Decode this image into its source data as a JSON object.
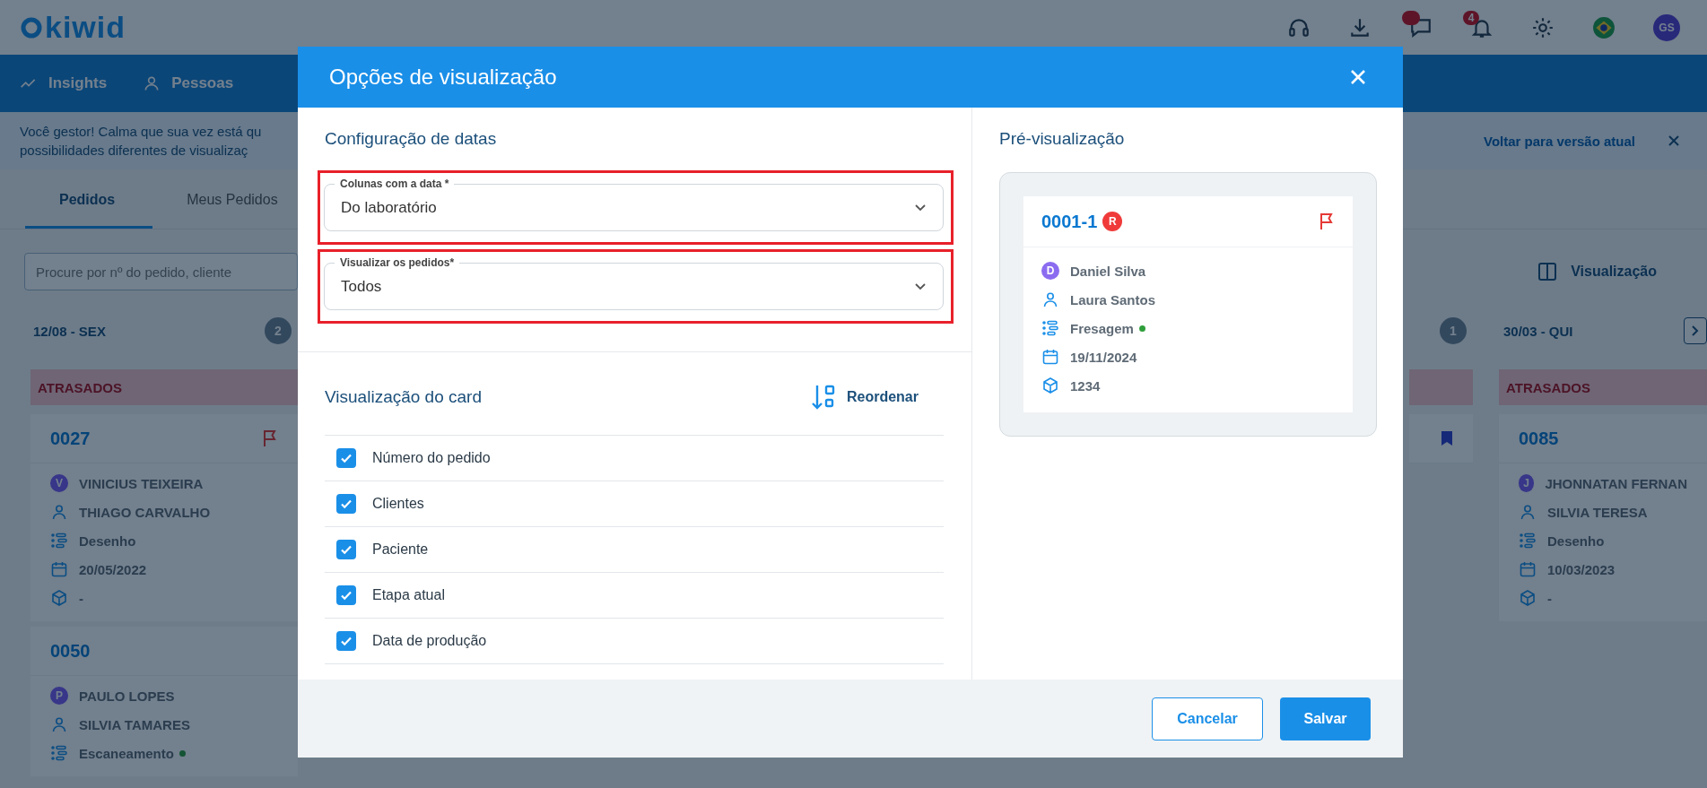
{
  "app_bar": {
    "logo": "kiwid",
    "actions": [
      {
        "kind": "headset"
      },
      {
        "kind": "download"
      },
      {
        "kind": "chat",
        "badge": true
      },
      {
        "kind": "bell",
        "badge": true,
        "count": "4"
      },
      {
        "kind": "settings"
      },
      {
        "kind": "flag"
      }
    ],
    "avatar": "GS"
  },
  "nav": [
    {
      "kind": "insights",
      "label": "Insights"
    },
    {
      "kind": "people",
      "label": "Pessoas"
    }
  ],
  "banner": {
    "lines": [
      "Você gestor! Calma que sua vez está qu",
      "possibilidades diferentes de visualizaç"
    ],
    "link": "Voltar para versão atual"
  },
  "tabs": [
    {
      "label": "Pedidos",
      "selected": true
    },
    {
      "label": "Meus Pedidos",
      "selected": false
    }
  ],
  "search": {
    "placeholder": "Procure por nº do pedido, cliente"
  },
  "view_button": "Visualização",
  "board": {
    "columns": [
      {
        "date": "12/08 - SEX",
        "count": "2",
        "group": "ATRASADOS",
        "cards": [
          {
            "number": "0027",
            "marker": {
              "kind": "flag"
            },
            "fields": [
              {
                "kind": "avatar",
                "initial": "V",
                "text": "VINICIUS TEIXEIRA"
              },
              {
                "kind": "person",
                "text": "THIAGO CARVALHO"
              },
              {
                "kind": "stage",
                "text": "Desenho"
              },
              {
                "kind": "date",
                "text": "20/05/2022"
              },
              {
                "kind": "box",
                "text": "-"
              }
            ]
          },
          {
            "number": "0050",
            "fields": [
              {
                "kind": "avatar",
                "initial": "P",
                "text": "PAULO LOPES"
              },
              {
                "kind": "person",
                "text": "SILVIA TAMARES"
              },
              {
                "kind": "stage",
                "text": "Escaneamento",
                "dot": true
              }
            ]
          }
        ]
      },
      {
        "count": "1",
        "cards": [
          {
            "marker": {
              "kind": "bookmark"
            }
          }
        ]
      },
      {
        "date": "30/03 - QUI",
        "next": true,
        "group": "ATRASADOS",
        "cards": [
          {
            "number": "0085",
            "fields": [
              {
                "kind": "avatar",
                "initial": "J",
                "text": "JHONNATAN FERNAN"
              },
              {
                "kind": "person",
                "text": "SILVIA TERESA"
              },
              {
                "kind": "stage",
                "text": "Desenho"
              },
              {
                "kind": "date",
                "text": "10/03/2023"
              },
              {
                "kind": "box",
                "text": "-"
              }
            ]
          }
        ]
      }
    ]
  },
  "modal": {
    "title": "Opções de visualização",
    "date_section": {
      "heading": "Configuração de datas",
      "fields": [
        {
          "label": "Colunas com a data *",
          "value": "Do laboratório",
          "highlighted": true
        },
        {
          "label": "Visualizar os pedidos*",
          "value": "Todos",
          "highlighted": true
        }
      ]
    },
    "card_section": {
      "heading": "Visualização do card",
      "reorder": "Reordenar",
      "options": [
        {
          "label": "Número do pedido",
          "checked": true
        },
        {
          "label": "Clientes",
          "checked": true
        },
        {
          "label": "Paciente",
          "checked": true
        },
        {
          "label": "Etapa atual",
          "checked": true
        },
        {
          "label": "Data de produção",
          "checked": true
        }
      ]
    },
    "preview": {
      "heading": "Pré-visualização",
      "card": {
        "number": "0001-1",
        "tag": "R",
        "marker": {
          "kind": "flag"
        },
        "fields": [
          {
            "kind": "avatar",
            "initial": "D",
            "text": "Daniel Silva"
          },
          {
            "kind": "person",
            "text": "Laura Santos"
          },
          {
            "kind": "stage",
            "text": "Fresagem",
            "dot": true
          },
          {
            "kind": "date",
            "text": "19/11/2024"
          },
          {
            "kind": "box",
            "text": "1234"
          }
        ]
      }
    },
    "buttons": [
      {
        "kind": "secondary",
        "label": "Cancelar"
      },
      {
        "kind": "primary",
        "label": "Salvar"
      }
    ]
  }
}
